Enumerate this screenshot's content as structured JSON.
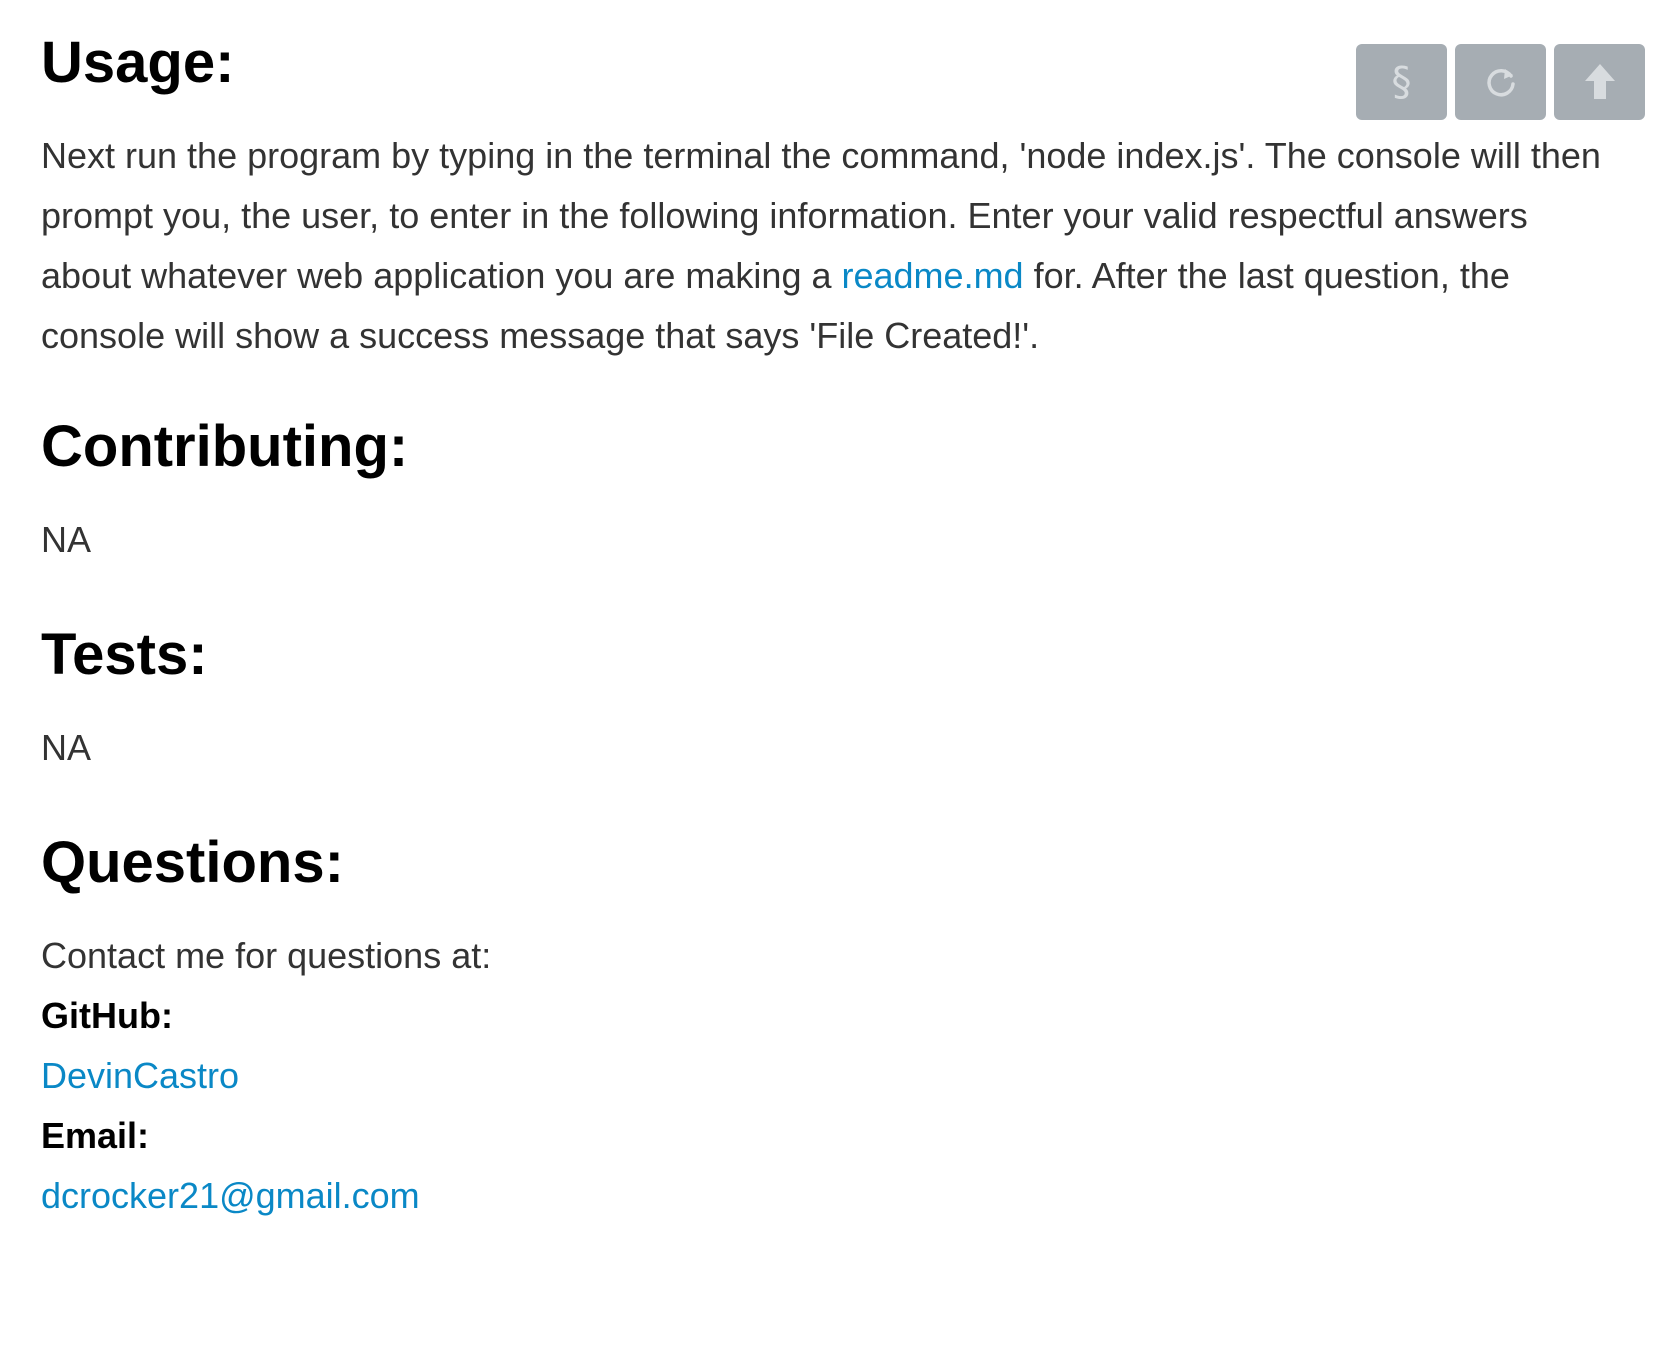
{
  "sections": {
    "usage": {
      "heading": "Usage:",
      "text_before_link": "Next run the program by typing in the terminal the command, 'node index.js'. The console will then prompt you, the user, to enter in the following information. Enter your valid respectful answers about whatever web application you are making a ",
      "link_text": "readme.md",
      "text_after_link": " for. After the last question, the console will show a success message that says 'File Created!'."
    },
    "contributing": {
      "heading": "Contributing:",
      "text": "NA"
    },
    "tests": {
      "heading": "Tests:",
      "text": "NA"
    },
    "questions": {
      "heading": "Questions:",
      "intro": "Contact me for questions at:",
      "github_label": "GitHub:",
      "github_link": "DevinCastro",
      "email_label": "Email:",
      "email_link": "dcrocker21@gmail.com"
    }
  },
  "toolbar": {
    "section_glyph": "§",
    "buttons": [
      {
        "icon": "section-icon"
      },
      {
        "icon": "refresh-icon"
      },
      {
        "icon": "arrow-up-icon"
      }
    ]
  },
  "colors": {
    "link": "#0a88c6",
    "heading": "#000000",
    "body_text": "#333333",
    "toolbar_button": "#a6adb3",
    "toolbar_icon": "#d8dcdf"
  }
}
